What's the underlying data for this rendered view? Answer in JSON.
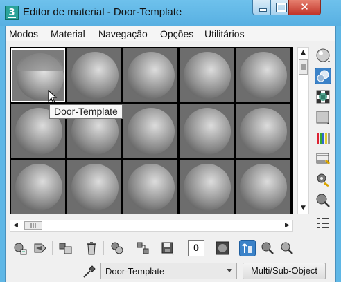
{
  "window": {
    "title": "Editor de material - Door-Template",
    "app_icon_label": "3"
  },
  "menu": [
    "Modos",
    "Material",
    "Navegação",
    "Opções",
    "Utilitários"
  ],
  "tooltip": "Door-Template",
  "material": {
    "name": "Door-Template",
    "type_button": "Multi/Sub-Object"
  },
  "toolbar": {
    "material_id_value": "0"
  },
  "slots": {
    "rows": 3,
    "columns": 5,
    "active_index": 0
  },
  "icons": {
    "side": [
      "sample-type-sphere-icon",
      "backlight-icon",
      "background-checker-icon",
      "sample-uv-tiling-icon",
      "video-color-check-icon",
      "make-preview-icon",
      "options-icon",
      "select-by-material-icon",
      "material-id-list-icon"
    ],
    "bottom": [
      "get-material-icon",
      "put-to-scene-icon",
      "assign-to-selection-icon",
      "reset-map-icon",
      "make-unique-icon",
      "put-to-library-icon",
      "save-icon",
      "material-id-channel-icon",
      "show-shaded-icon",
      "show-end-result-icon",
      "go-to-parent-icon",
      "go-forward-sibling-icon"
    ],
    "eyedropper": "pick-material-eyedropper-icon"
  },
  "colors": {
    "title_bar": "#5fb7e6",
    "close_button": "#c7372c",
    "active_toggle": "#3b82c8"
  }
}
